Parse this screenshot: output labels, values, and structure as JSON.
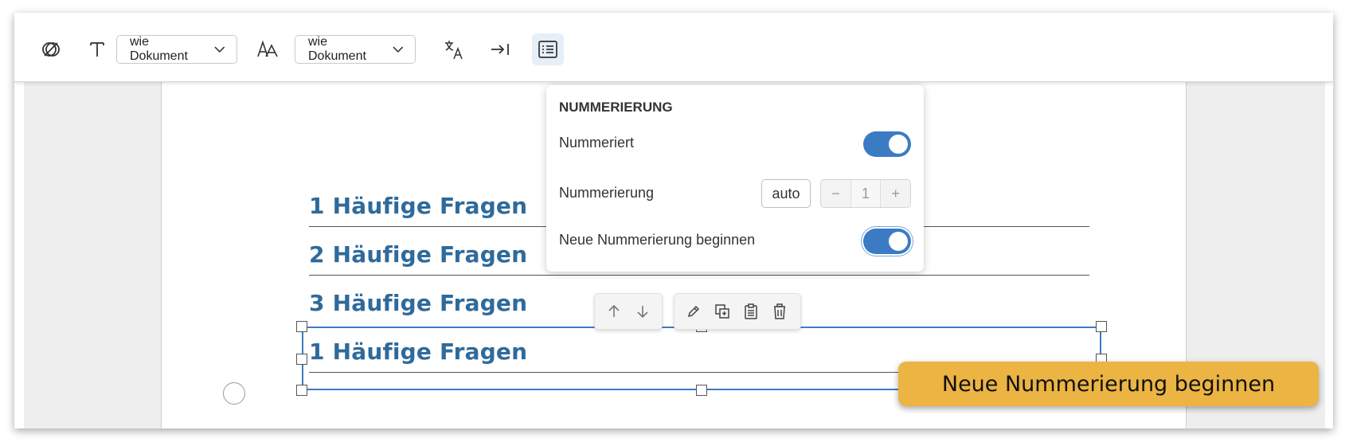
{
  "toolbar": {
    "font_size_select": "wie Dokument",
    "font_style_select": "wie Dokument",
    "icons": [
      "no-style-icon",
      "text-icon",
      "font-size-icon",
      "translate-icon",
      "indent-icon",
      "numbered-list-icon"
    ]
  },
  "document": {
    "headings": [
      {
        "number": "1",
        "text": "1 Häufige Fragen"
      },
      {
        "number": "2",
        "text": "2 Häufige Fragen"
      },
      {
        "number": "3",
        "text": "3 Häufige Fragen"
      },
      {
        "number": "1",
        "text": "1 Häufige Fragen"
      }
    ]
  },
  "numbering_popup": {
    "title": "NUMMERIERUNG",
    "numbered_label": "Nummeriert",
    "numbered_on": true,
    "numbering_label": "Nummerierung",
    "auto_label": "auto",
    "stepper_minus": "−",
    "stepper_value": "1",
    "stepper_plus": "+",
    "restart_label": "Neue Nummerierung beginnen",
    "restart_on": true
  },
  "block_toolbar": {
    "icons": [
      "arrow-up-icon",
      "arrow-down-icon",
      "pencil-icon",
      "duplicate-icon",
      "clipboard-icon",
      "trash-icon"
    ]
  },
  "tooltip": {
    "text": "Neue Nummerierung beginnen"
  },
  "colors": {
    "accent": "#3b7bc4",
    "heading": "#2f6a9a",
    "tooltip": "#ecb443"
  }
}
